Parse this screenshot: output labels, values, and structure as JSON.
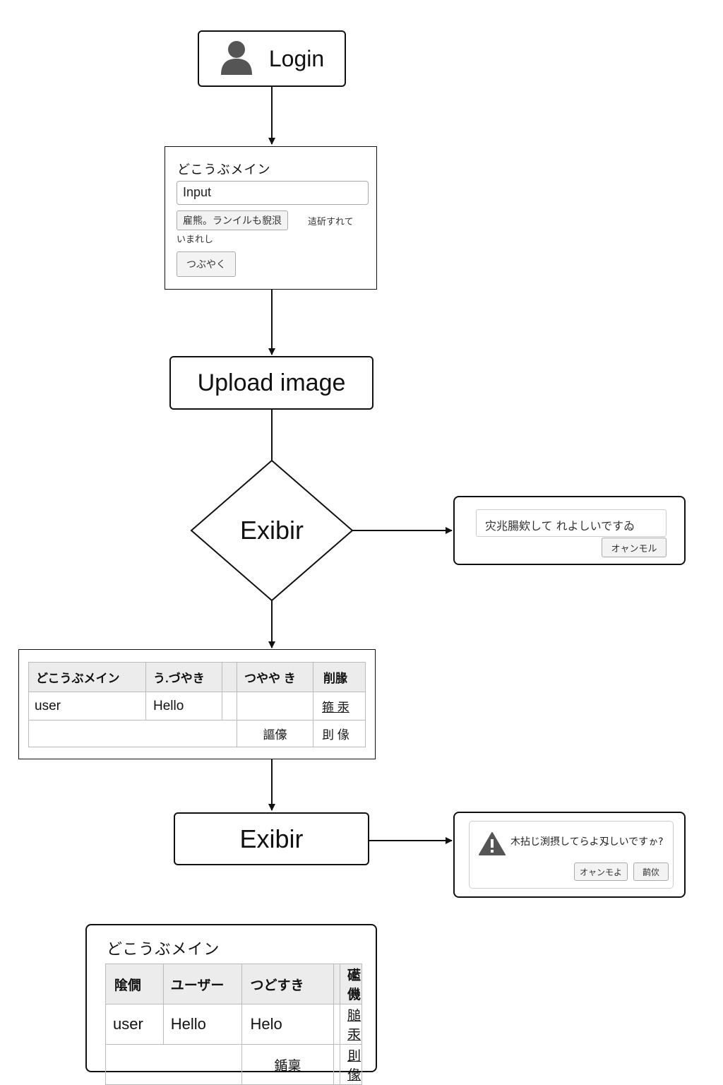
{
  "login": {
    "label": "Login",
    "icon": "user-icon"
  },
  "form1": {
    "title": "どこうぶメイン",
    "input_value": "Input",
    "file_button": "雇熊。ランイルも貎泿",
    "file_status_line1": "迼斫すれて",
    "file_status_line2": "いまれし",
    "submit_button": "つぶやく"
  },
  "upload": {
    "label": "Upload image"
  },
  "decision": {
    "label": "Exibir"
  },
  "dialog1": {
    "message": "灾兆腸欸して れよしいですゐ",
    "cancel_button": "オャンモル"
  },
  "table1": {
    "headers": [
      "どこうぶメイン",
      "う.づやき",
      "",
      "つやや き",
      "削腞"
    ],
    "row1": {
      "user": "user",
      "tweet": "Hello",
      "empty1": "",
      "empty2": "",
      "action": "箍 汞"
    },
    "row2": {
      "edit": "謳儫",
      "delete": "刞 㑰"
    }
  },
  "exibir2": {
    "label": "Exibir"
  },
  "dialog2": {
    "icon": "warning-icon",
    "message": "木拈じ渕摂してらよ刄しいですゕ?",
    "cancel_button": "オャンモよ",
    "delete_button": "鹋佽"
  },
  "panel3": {
    "title": "どこうぶメイン",
    "headers": [
      "隂僩",
      "ユーザー",
      "つどすき",
      "",
      "礷僟"
    ],
    "row1": {
      "user": "user",
      "tweet": "Hello",
      "tweet2": "Helo",
      "empty": "",
      "action": "膇汞"
    },
    "row2": {
      "edit": "鍎稟",
      "delete": "刞㑰"
    }
  }
}
